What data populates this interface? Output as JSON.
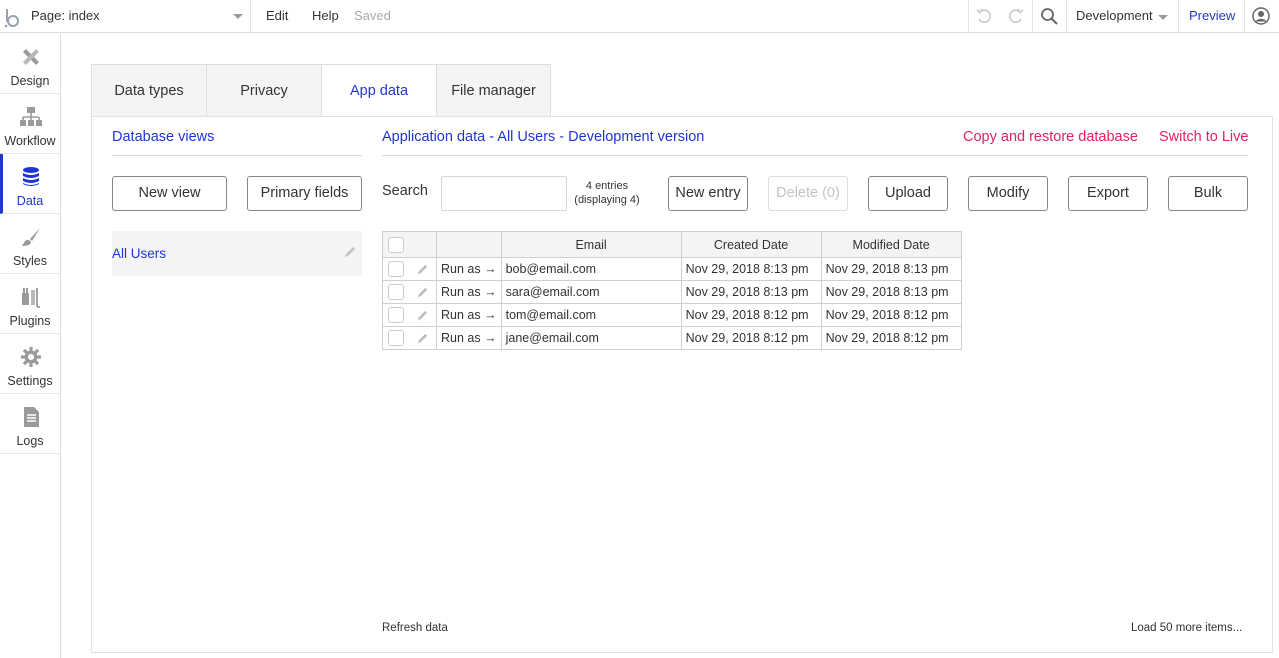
{
  "topbar": {
    "page_label": "Page: index",
    "edit": "Edit",
    "help": "Help",
    "saved": "Saved",
    "environment": "Development",
    "preview": "Preview"
  },
  "sidebar": {
    "items": [
      {
        "label": "Design",
        "icon": "design-icon"
      },
      {
        "label": "Workflow",
        "icon": "workflow-icon"
      },
      {
        "label": "Data",
        "icon": "database-icon",
        "active": true
      },
      {
        "label": "Styles",
        "icon": "brush-icon"
      },
      {
        "label": "Plugins",
        "icon": "plugin-icon"
      },
      {
        "label": "Settings",
        "icon": "gear-icon"
      },
      {
        "label": "Logs",
        "icon": "document-icon"
      }
    ]
  },
  "tabs": [
    "Data types",
    "Privacy",
    "App data",
    "File manager"
  ],
  "active_tab": "App data",
  "database_views": {
    "title": "Database views",
    "new_view": "New view",
    "primary_fields": "Primary fields",
    "views": [
      "All Users"
    ]
  },
  "app_data": {
    "title": "Application data - All Users - Development version",
    "copy_restore": "Copy and restore database",
    "switch_live": "Switch to Live",
    "search_label": "Search",
    "search_value": "",
    "entries_line1": "4 entries",
    "entries_line2": "(displaying 4)",
    "buttons": {
      "new_entry": "New entry",
      "delete": "Delete (0)",
      "upload": "Upload",
      "modify": "Modify",
      "export": "Export",
      "bulk": "Bulk"
    },
    "columns": [
      "Email",
      "Created Date",
      "Modified Date"
    ],
    "run_as": "Run as →",
    "rows": [
      {
        "email": "bob@email.com",
        "created": "Nov 29, 2018 8:13 pm",
        "modified": "Nov 29, 2018 8:13 pm"
      },
      {
        "email": "sara@email.com",
        "created": "Nov 29, 2018 8:13 pm",
        "modified": "Nov 29, 2018 8:13 pm"
      },
      {
        "email": "tom@email.com",
        "created": "Nov 29, 2018 8:12 pm",
        "modified": "Nov 29, 2018 8:12 pm"
      },
      {
        "email": "jane@email.com",
        "created": "Nov 29, 2018 8:12 pm",
        "modified": "Nov 29, 2018 8:12 pm"
      }
    ],
    "refresh": "Refresh data",
    "load_more": "Load 50 more items..."
  },
  "colors": {
    "accent": "#1f36d1",
    "danger": "#e0245e"
  }
}
